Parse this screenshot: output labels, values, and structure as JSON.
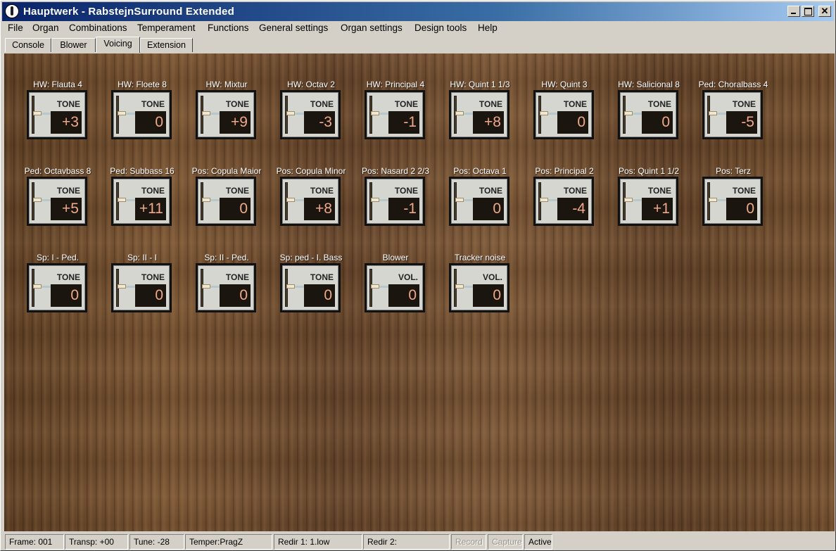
{
  "window": {
    "title": "Hauptwerk - RabstejnSurround Extended"
  },
  "menu": [
    "File",
    "Organ",
    "Combinations",
    "Temperament",
    "Functions",
    "General settings",
    "Organ settings",
    "Design tools",
    "Help"
  ],
  "tabs": [
    {
      "label": "Console",
      "active": false
    },
    {
      "label": "Blower",
      "active": false
    },
    {
      "label": "Voicing",
      "active": true
    },
    {
      "label": "Extension",
      "active": false
    }
  ],
  "controls": [
    {
      "label": "HW: Flauta 4",
      "kind": "TONE",
      "value": "+3"
    },
    {
      "label": "HW: Floete 8",
      "kind": "TONE",
      "value": "0"
    },
    {
      "label": "HW: Mixtur",
      "kind": "TONE",
      "value": "+9"
    },
    {
      "label": "HW: Octav 2",
      "kind": "TONE",
      "value": "-3"
    },
    {
      "label": "HW: Principal 4",
      "kind": "TONE",
      "value": "-1"
    },
    {
      "label": "HW: Quint 1 1/3",
      "kind": "TONE",
      "value": "+8"
    },
    {
      "label": "HW: Quint 3",
      "kind": "TONE",
      "value": "0"
    },
    {
      "label": "HW: Salicional 8",
      "kind": "TONE",
      "value": "0"
    },
    {
      "label": "Ped: Choralbass 4",
      "kind": "TONE",
      "value": "-5"
    },
    {
      "label": "Ped: Octavbass 8",
      "kind": "TONE",
      "value": "+5"
    },
    {
      "label": "Ped: Subbass 16",
      "kind": "TONE",
      "value": "+11"
    },
    {
      "label": "Pos: Copula Maior",
      "kind": "TONE",
      "value": "0"
    },
    {
      "label": "Pos: Copula Minor",
      "kind": "TONE",
      "value": "+8"
    },
    {
      "label": "Pos: Nasard 2 2/3",
      "kind": "TONE",
      "value": "-1"
    },
    {
      "label": "Pos: Octava 1",
      "kind": "TONE",
      "value": "0"
    },
    {
      "label": "Pos: Principal 2",
      "kind": "TONE",
      "value": "-4"
    },
    {
      "label": "Pos: Quint 1 1/2",
      "kind": "TONE",
      "value": "+1"
    },
    {
      "label": "Pos: Terz",
      "kind": "TONE",
      "value": "0"
    },
    {
      "label": "Sp: I - Ped.",
      "kind": "TONE",
      "value": "0"
    },
    {
      "label": "Sp: II - I",
      "kind": "TONE",
      "value": "0"
    },
    {
      "label": "Sp: II - Ped.",
      "kind": "TONE",
      "value": "0"
    },
    {
      "label": "Sp: ped - I. Bass",
      "kind": "TONE",
      "value": "0"
    },
    {
      "label": "Blower",
      "kind": "VOL.",
      "value": "0"
    },
    {
      "label": "Tracker noise",
      "kind": "VOL.",
      "value": "0"
    }
  ],
  "status": [
    {
      "text": "Frame: 001",
      "enabled": true
    },
    {
      "text": "Transp: +00",
      "enabled": true
    },
    {
      "text": "Tune: -28",
      "enabled": true
    },
    {
      "text": "Temper:PragZ",
      "enabled": true
    },
    {
      "text": "Redir 1: 1.low",
      "enabled": true
    },
    {
      "text": "Redir 2:",
      "enabled": true
    },
    {
      "text": "Record",
      "enabled": false
    },
    {
      "text": "Capture",
      "enabled": false
    },
    {
      "text": "Active",
      "enabled": true
    }
  ],
  "colors": {
    "title_gradient_start": "#0a246a",
    "title_gradient_end": "#a6caf0",
    "value_text": "#f0a888",
    "wood": "#6b4a2c"
  }
}
